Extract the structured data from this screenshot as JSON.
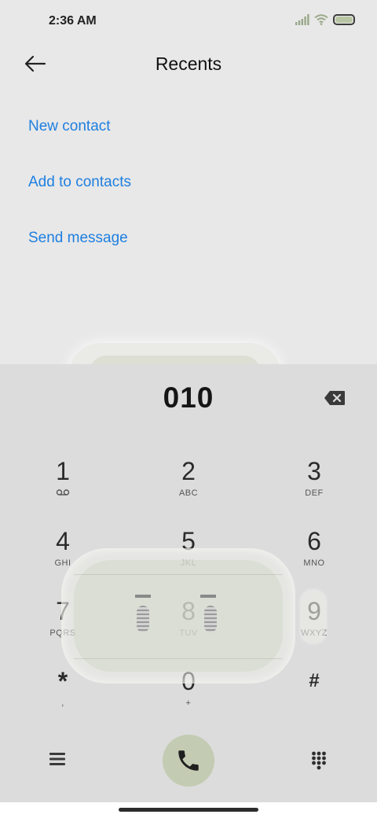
{
  "status_bar": {
    "time": "2:36 AM",
    "icons": [
      "signal-icon",
      "wifi-icon",
      "battery-icon"
    ],
    "battery_color": "#b9c6a6"
  },
  "header": {
    "back_icon": "arrow-left-icon",
    "title": "Recents"
  },
  "actions": [
    "New contact",
    "Add to contacts",
    "Send message"
  ],
  "colors": {
    "accent": "#1e7fe0",
    "call_button": "#c3cbb2",
    "dialpad_bg": "#dcdcdc",
    "page_bg": "#e8e8e8"
  },
  "dialpad": {
    "number": "010",
    "backspace_icon": "backspace-icon",
    "keys": [
      {
        "digit": "1",
        "letters": ""
      },
      {
        "digit": "2",
        "letters": "ABC"
      },
      {
        "digit": "3",
        "letters": "DEF"
      },
      {
        "digit": "4",
        "letters": "GHI"
      },
      {
        "digit": "5",
        "letters": "JKL"
      },
      {
        "digit": "6",
        "letters": "MNO"
      },
      {
        "digit": "7",
        "letters": "PQRS"
      },
      {
        "digit": "8",
        "letters": "TUV"
      },
      {
        "digit": "9",
        "letters": "WXYZ"
      },
      {
        "digit": "*",
        "letters": ","
      },
      {
        "digit": "0",
        "letters": "+"
      },
      {
        "digit": "#",
        "letters": ""
      }
    ],
    "voicemail_icon": "voicemail-icon"
  },
  "bottom_bar": {
    "menu_icon": "menu-icon",
    "call_icon": "phone-icon",
    "dialpad_toggle_icon": "dialpad-icon"
  }
}
